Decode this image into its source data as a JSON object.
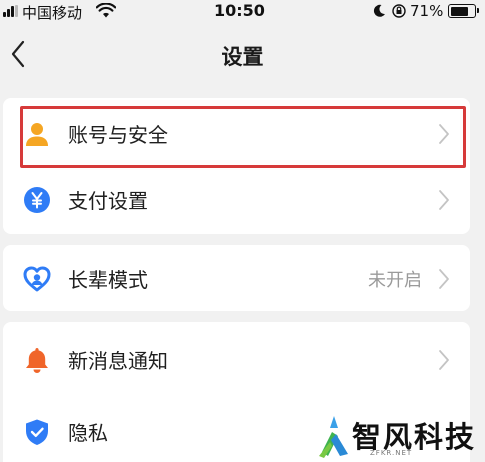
{
  "status_bar": {
    "carrier": "中国移动",
    "time": "10:50",
    "battery_percent": "71%",
    "battery_level": 0.71,
    "icons": [
      "signal-icon",
      "wifi-icon",
      "moon-icon",
      "orientation-lock-icon",
      "battery-icon"
    ]
  },
  "nav": {
    "title": "设置",
    "back_icon": "chevron-left-icon"
  },
  "settings": [
    {
      "group": 1,
      "items": [
        {
          "label": "账号与安全",
          "icon": "person-icon",
          "icon_color": "#f5a623",
          "highlighted": true
        },
        {
          "label": "支付设置",
          "icon": "yuan-icon",
          "icon_color": "#2f7cf6"
        }
      ]
    },
    {
      "group": 2,
      "items": [
        {
          "label": "长辈模式",
          "icon": "heart-icon",
          "icon_color": "#2f7cf6",
          "value": "未开启"
        }
      ]
    },
    {
      "group": 3,
      "items": [
        {
          "label": "新消息通知",
          "icon": "bell-icon",
          "icon_color": "#f0652a"
        },
        {
          "label": "隐私",
          "icon": "shield-icon",
          "icon_color": "#2f7cf6"
        }
      ]
    }
  ],
  "colors": {
    "background": "#f1f1f1",
    "card": "#ffffff",
    "highlight_border": "#d63a3a",
    "chevron": "#c4c4c4"
  },
  "watermark": {
    "text": "智风科技",
    "sub": "ZFKR.NET"
  }
}
